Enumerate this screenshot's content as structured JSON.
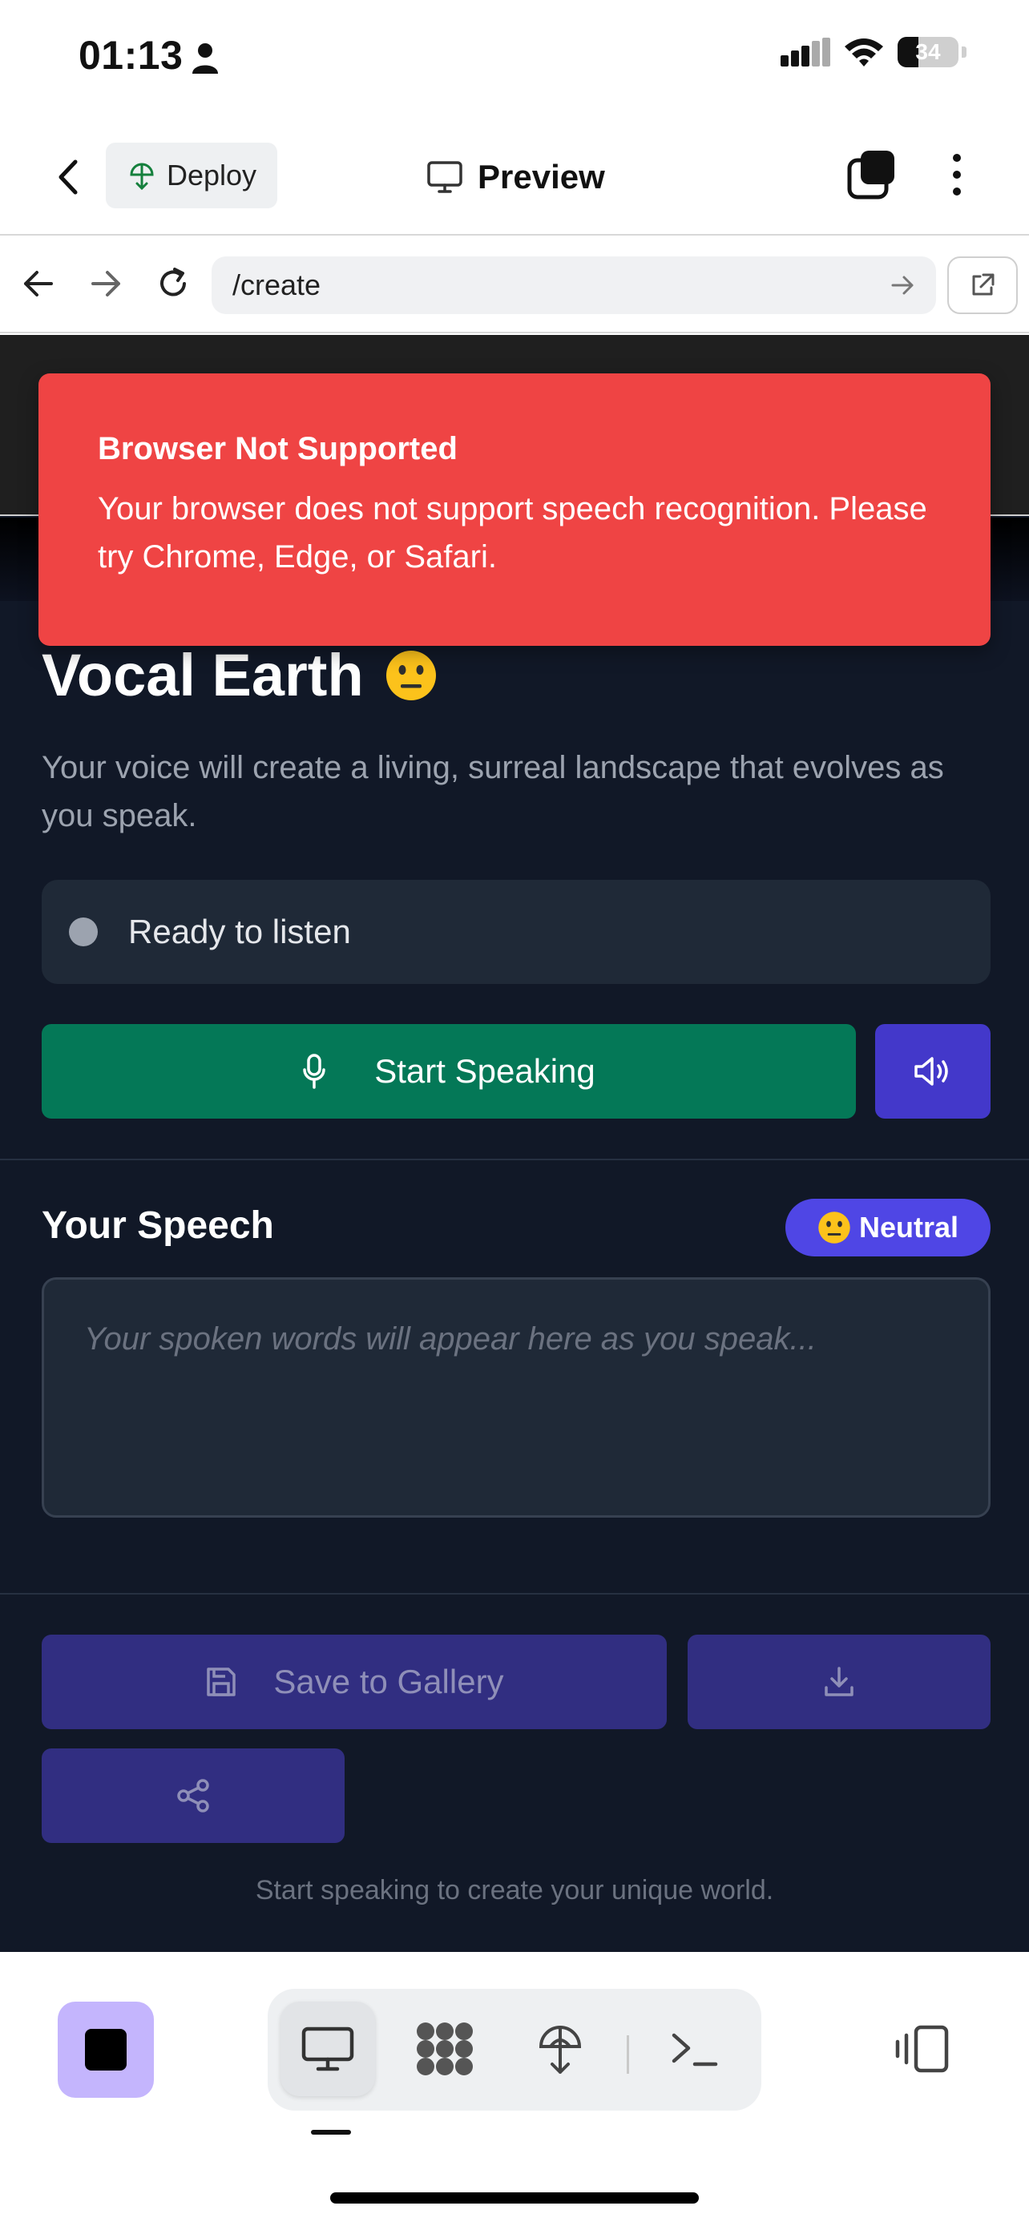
{
  "status_bar": {
    "time": "01:13",
    "battery": "34"
  },
  "toolbar": {
    "deploy_label": "Deploy",
    "title": "Preview"
  },
  "browser": {
    "url": "/create"
  },
  "toast": {
    "title": "Browser Not Supported",
    "message": "Your browser does not support speech recognition. Please try Chrome, Edge, or Safari."
  },
  "page": {
    "title": "Vocal Earth",
    "description": "Your voice will create a living, surreal landscape that evolves as you speak.",
    "status": "Ready to listen",
    "start_label": "Start Speaking",
    "speech_heading": "Your Speech",
    "mood_label": "Neutral",
    "speech_placeholder": "Your spoken words will appear here as you speak...",
    "save_label": "Save to Gallery",
    "hint": "Start speaking to create your unique world."
  },
  "colors": {
    "toast": "#ef4444",
    "primary_green": "#047857",
    "indigo": "#4338ca",
    "badge": "#4f46e5",
    "background": "#111827"
  }
}
